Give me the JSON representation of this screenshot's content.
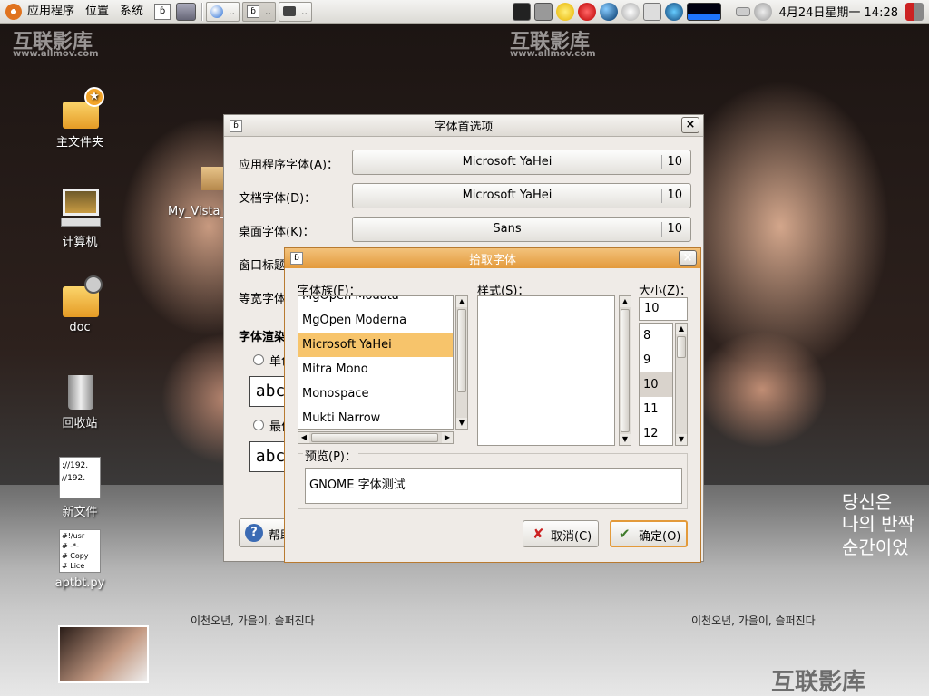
{
  "panel": {
    "menus": [
      "应用程序",
      "位置",
      "系统"
    ],
    "tasks": [
      "..",
      "..",
      ".."
    ],
    "clock": "4月24日星期一 14:28"
  },
  "desktop": {
    "watermark_left": "互联影库",
    "watermark_url_left": "www.allmov.com",
    "watermark_right": "互联影库",
    "watermark_url_right": "www.allmov.com",
    "watermark_bottom": "互联影库",
    "poster_korean_1": "당신은",
    "poster_korean_2": "나의 반짝",
    "poster_korean_3": "순간이었",
    "poster_caption_left": "이천오년, 가을이, 슬퍼진다",
    "poster_caption_right": "이천오년, 가을이, 슬퍼진다",
    "icons": [
      {
        "label": "主文件夹"
      },
      {
        "label": "My_Vista_"
      },
      {
        "label": "计算机"
      },
      {
        "label": "doc"
      },
      {
        "label": "回收站"
      },
      {
        "label": "新文件"
      },
      {
        "label": "aptbt.py"
      }
    ],
    "file_thumb_text": [
      "://192.",
      "//192."
    ],
    "script_thumb_text": [
      "#!/usr",
      "# -*-",
      "# Copy",
      "# Lice"
    ]
  },
  "prefs": {
    "title": "字体首选项",
    "rows": [
      {
        "label": "应用程序字体(A)：",
        "font": "Microsoft YaHei",
        "size": "10"
      },
      {
        "label": "文档字体(D)：",
        "font": "Microsoft YaHei",
        "size": "10"
      },
      {
        "label": "桌面字体(K)：",
        "font": "Sans",
        "size": "10"
      },
      {
        "label": "窗口标题"
      },
      {
        "label": "等宽字体"
      }
    ],
    "rendering_label": "字体渲染",
    "option_1": "单色",
    "option_2": "最佳",
    "sample_1": "abc",
    "sample_2": "abc",
    "help_label": "帮助"
  },
  "picker": {
    "title": "拾取字体",
    "family_label": "字体族(F)：",
    "style_label": "样式(S)：",
    "size_label": "大小(Z)：",
    "families": [
      "MgOpen Modata",
      "MgOpen Moderna",
      "Microsoft YaHei",
      "Mitra Mono",
      "Monospace",
      "Mukti Narrow"
    ],
    "selected_family": 2,
    "size_value": "10",
    "sizes": [
      "8",
      "9",
      "10",
      "11",
      "12"
    ],
    "selected_size": 2,
    "preview_label": "预览(P)：",
    "preview_text": "GNOME 字体测试",
    "cancel_label": "取消(C)",
    "ok_label": "确定(O)"
  },
  "colors": {
    "accent": "#f7c46b",
    "titlebar_active": "#e7a44e",
    "ok_border": "#e39a3a"
  }
}
